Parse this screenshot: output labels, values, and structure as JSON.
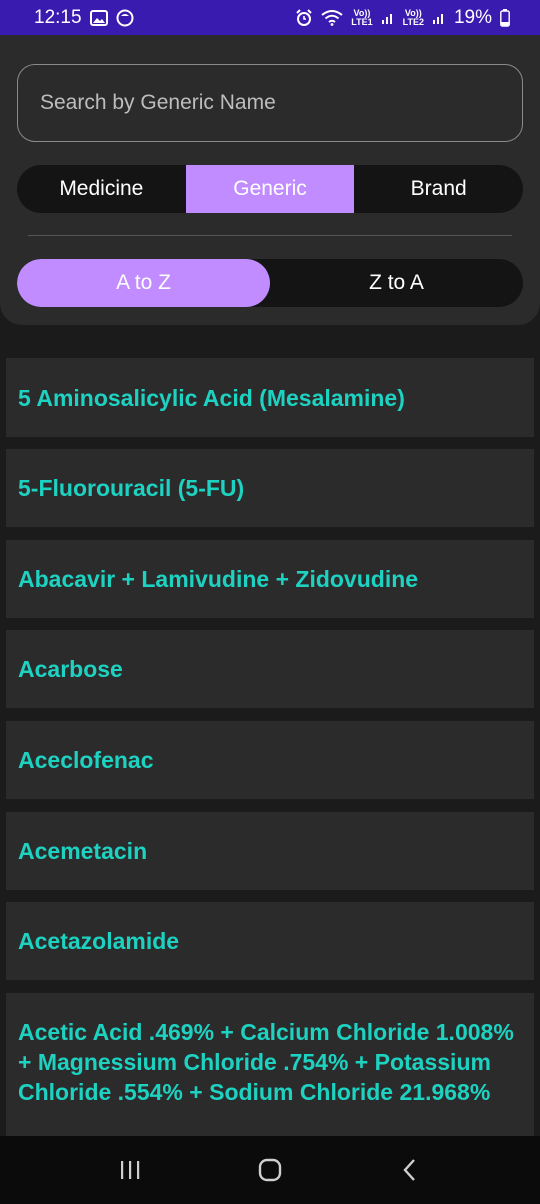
{
  "status_bar": {
    "time": "12:15",
    "battery": "19%",
    "sim1": "Vo))\nLTE1",
    "sim2": "Vo))\nLTE2"
  },
  "search": {
    "placeholder": "Search by Generic Name"
  },
  "category_tabs": [
    {
      "label": "Medicine",
      "active": false
    },
    {
      "label": "Generic",
      "active": true
    },
    {
      "label": "Brand",
      "active": false
    }
  ],
  "sort_tabs": [
    {
      "label": "A to Z",
      "active": true
    },
    {
      "label": "Z to A",
      "active": false
    }
  ],
  "generics": [
    "5 Aminosalicylic Acid (Mesalamine)",
    "5-Fluorouracil (5-FU)",
    "Abacavir + Lamivudine + Zidovudine",
    "Acarbose",
    "Aceclofenac",
    "Acemetacin",
    "Acetazolamide",
    "Acetic Acid .469% + Calcium Chloride 1.008% + Magnessium Chloride .754% + Potassium Chloride .554% + Sodium Chloride 21.968%"
  ],
  "colors": {
    "accent": "#c08cff",
    "item_text": "#1ed2c2",
    "status_bar": "#3a1bb0"
  },
  "nav_icons": [
    "recents-icon",
    "home-icon",
    "back-icon"
  ]
}
